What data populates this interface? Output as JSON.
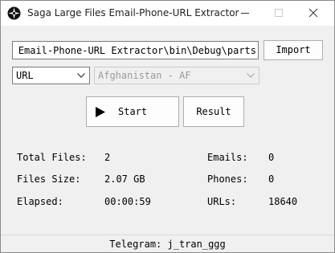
{
  "window": {
    "title": "Saga Large Files Email-Phone-URL Extractor",
    "icon": "compass-icon"
  },
  "path": {
    "value": "e Email-Phone-URL Extractor\\bin\\Debug\\parts"
  },
  "buttons": {
    "import": "Import",
    "start": "Start",
    "result": "Result"
  },
  "selects": {
    "type_value": "URL",
    "country_value": "Afghanistan - AF",
    "country_enabled": false
  },
  "stats": {
    "total_files_label": "Total Files:",
    "total_files_value": "2",
    "files_size_label": "Files Size:",
    "files_size_value": "2.07 GB",
    "elapsed_label": "Elapsed:",
    "elapsed_value": "00:00:59",
    "emails_label": "Emails:",
    "emails_value": "0",
    "phones_label": "Phones:",
    "phones_value": "0",
    "urls_label": "URLs:",
    "urls_value": "18640"
  },
  "status": {
    "text": "Telegram: j_tran_ggg"
  }
}
